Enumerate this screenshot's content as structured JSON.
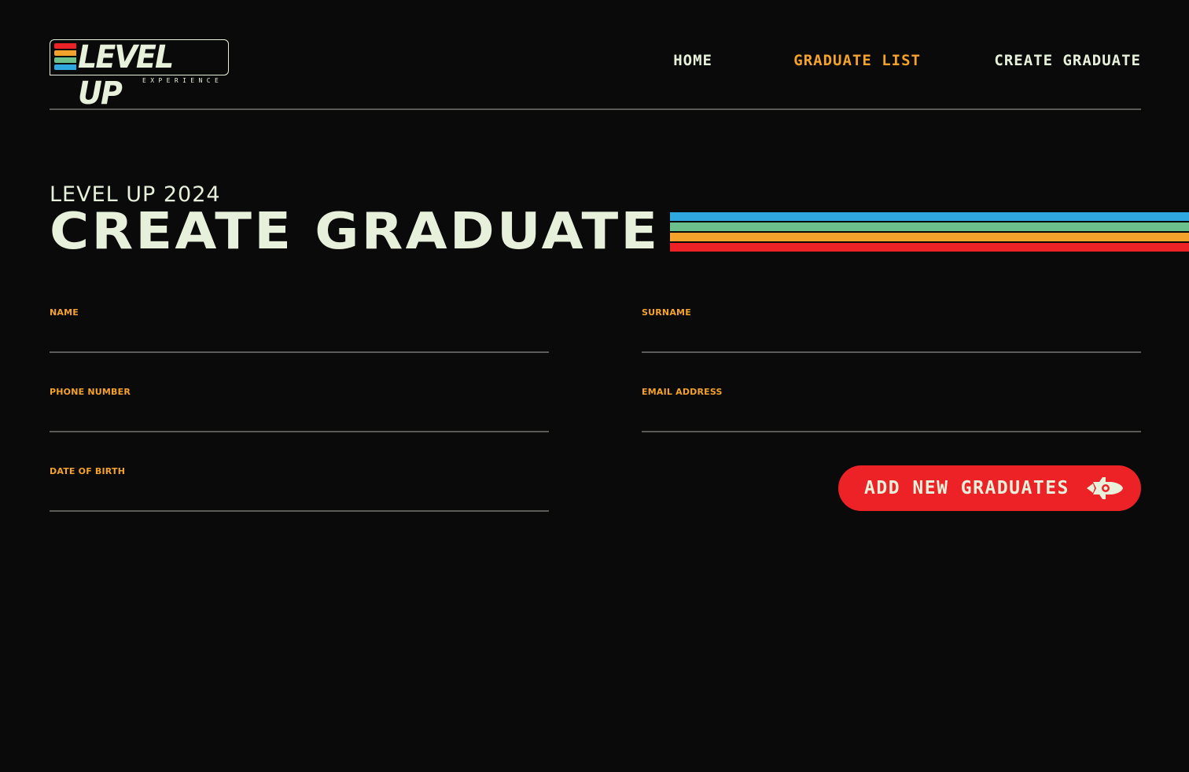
{
  "brand": {
    "logo_text": "LEVEL UP",
    "logo_subtext": "EXPERIENCE",
    "stripe_colors": [
      "#ec2227",
      "#f3a32b",
      "#6cc08b",
      "#2ea8df"
    ]
  },
  "nav": {
    "items": [
      {
        "label": "HOME",
        "active": false
      },
      {
        "label": "GRADUATE LIST",
        "active": true
      },
      {
        "label": "CREATE GRADUATE",
        "active": false
      }
    ]
  },
  "hero": {
    "eyebrow": "LEVEL UP 2024",
    "title": "CREATE GRADUATE",
    "stripe_colors": [
      "#2ea8df",
      "#6cc08b",
      "#f3a32b",
      "#ec2227"
    ]
  },
  "form": {
    "name": {
      "label": "NAME",
      "value": ""
    },
    "surname": {
      "label": "SURNAME",
      "value": ""
    },
    "phone": {
      "label": "PHONE NUMBER",
      "value": ""
    },
    "email": {
      "label": "EMAIL ADDRESS",
      "value": ""
    },
    "dob": {
      "label": "DATE OF BIRTH",
      "value": ""
    },
    "submit_label": "ADD NEW GRADUATES",
    "submit_icon": "rocket-icon"
  },
  "colors": {
    "background": "#0a0a0a",
    "text": "#e6f0da",
    "accent": "#f3a32b",
    "button": "#ec2227"
  }
}
